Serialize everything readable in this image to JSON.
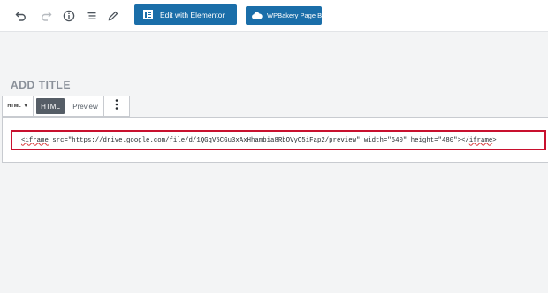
{
  "toolbar": {
    "icons": [
      "undo-icon",
      "redo-icon",
      "info-icon",
      "list-icon",
      "pencil-icon"
    ],
    "elementor_button": "Edit with Elementor",
    "wpbakery_button": "WPBakery Page Builder"
  },
  "editor": {
    "title_placeholder": "ADD TITLE",
    "block_switcher": "HTML",
    "tab_html": "HTML",
    "tab_preview": "Preview",
    "code_open_tag": "<iframe",
    "code_body": " src=\"https://drive.google.com/file/d/1QGqV5CGu3xAxHhambia8RbOVyO5iFap2/preview\" width=\"640\" height=\"480\"></",
    "code_close_tag": "iframe",
    "code_end": ">"
  },
  "colors": {
    "accent": "#1a6ea9",
    "highlight_border": "#c8102e",
    "html_tab_active": "#555d66"
  }
}
